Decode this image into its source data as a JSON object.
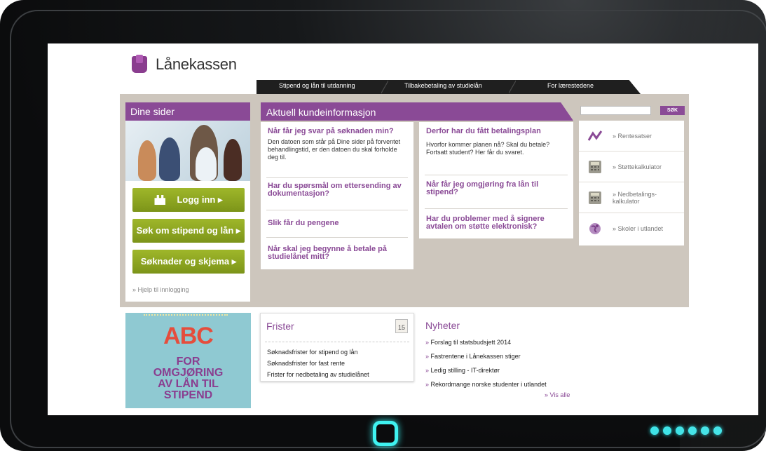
{
  "brand": {
    "name": "Lånekassen"
  },
  "nav": [
    "Stipend og lån til utdanning",
    "Tilbakebetaling av studielån",
    "For lærestedene"
  ],
  "dine_sider": {
    "title": "Dine sider",
    "buttons": [
      "Logg inn ▸",
      "Søk om stipend og lån ▸",
      "Søknader og skjema ▸"
    ],
    "help": "» Hjelp til innlogging"
  },
  "aktuell": {
    "title": "Aktuell kundeinformasjon",
    "left": [
      {
        "q": "Når får jeg svar på søknaden min?",
        "a": "Den datoen som står på Dine sider på forventet behandlingstid, er den datoen du skal forholde deg til."
      },
      {
        "q": "Har du spørsmål om ettersending av dokumentasjon?"
      },
      {
        "q": "Slik får du pengene"
      },
      {
        "q": "Når skal jeg begynne å betale på studielånet mitt?"
      }
    ],
    "right": [
      {
        "q": "Derfor har du fått betalingsplan",
        "a": "Hvorfor kommer planen nå? Skal du betale? Fortsatt student? Her får du svaret."
      },
      {
        "q": "Når får jeg omgjøring fra lån til stipend?"
      },
      {
        "q": "Har du problemer med å signere avtalen om støtte elektronisk?"
      }
    ]
  },
  "search": {
    "button": "SØK",
    "placeholder": ""
  },
  "quicklinks": [
    "» Rentesatser",
    "» Støttekalkulator",
    "» Nedbetalings- kalkulator",
    "» Skoler i utlandet"
  ],
  "promo": {
    "big": "ABC",
    "lines": [
      "FOR",
      "OMGJØRING",
      "AV LÅN TIL",
      "STIPEND"
    ]
  },
  "frister": {
    "title": "Frister",
    "calendar": "15",
    "items": [
      "Søknadsfrister for stipend og lån",
      "Søknadsfrister for fast rente",
      "Frister for nedbetaling av studielånet"
    ]
  },
  "nyheter": {
    "title": "Nyheter",
    "items": [
      "Forslag til statsbudsjett 2014",
      "Fastrentene i Lånekassen stiger",
      "Ledig stilling - IT-direktør",
      "Rekordmange norske studenter i utlandet"
    ],
    "more": "» Vis alle"
  },
  "colors": {
    "purple": "#8a4a96",
    "green": "#8aa322",
    "tablet_accent": "#3ff2f0"
  }
}
